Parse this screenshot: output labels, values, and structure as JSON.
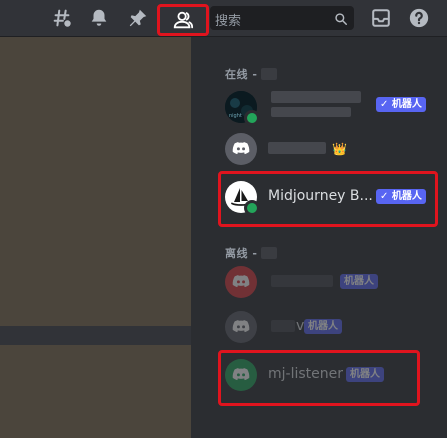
{
  "header": {
    "search_placeholder": "搜索",
    "icons": [
      "threads-icon",
      "bell-icon",
      "pin-icon",
      "members-icon",
      "search-icon",
      "inbox-icon",
      "help-icon"
    ]
  },
  "members": {
    "online_header": "在线 -",
    "offline_header": "离线 -",
    "online": [
      {
        "name": "",
        "badge": "✓ 机器人",
        "avatar_color": "#0b1a20",
        "status": "online"
      },
      {
        "name": "",
        "badge": "👑",
        "avatar_color": "#5c5e66",
        "status": "none"
      },
      {
        "name": "Midjourney B...",
        "badge": "✓ 机器人",
        "avatar_color": "#ffffff",
        "status": "online"
      }
    ],
    "offline": [
      {
        "name": "",
        "badge": "机器人",
        "avatar_color": "#da373c"
      },
      {
        "name": "v",
        "badge": "机器人",
        "avatar_color": "#5c5e66"
      },
      {
        "name": "mj-listener",
        "badge": "机器人",
        "avatar_color": "#23a55a"
      }
    ]
  },
  "colors": {
    "accent": "#5865f2",
    "highlight": "#e0141e",
    "online": "#23a55a"
  }
}
